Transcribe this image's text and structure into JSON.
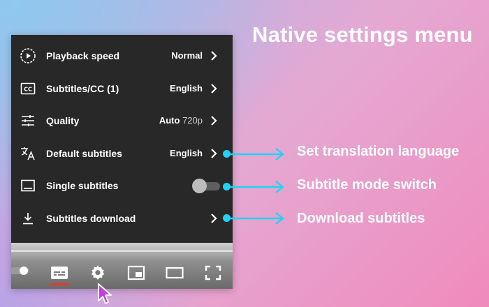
{
  "headline": "Native settings menu",
  "settings_menu": {
    "items": [
      {
        "label": "Playback speed",
        "value": "Normal",
        "icon": "playback-speed-icon"
      },
      {
        "label": "Subtitles/CC (1)",
        "value": "English",
        "icon": "closed-captions-icon"
      },
      {
        "label": "Quality",
        "value": "Auto",
        "value_sub": "720p",
        "icon": "quality-sliders-icon"
      },
      {
        "label": "Default subtitles",
        "value": "English",
        "icon": "translate-icon"
      },
      {
        "label": "Single subtitles",
        "toggle_on": false,
        "icon": "subtitles-box-icon"
      },
      {
        "label": "Subtitles download",
        "icon": "download-icon"
      }
    ]
  },
  "player_controls": {
    "buttons": [
      "autoplay-toggle-icon",
      "subtitles-icon",
      "settings-gear-icon",
      "miniplayer-icon",
      "theater-mode-icon",
      "fullscreen-icon"
    ],
    "subtitles_active": true
  },
  "callouts": [
    {
      "label": "Set translation language"
    },
    {
      "label": "Subtitle mode switch"
    },
    {
      "label": "Download subtitles"
    }
  ],
  "colors": {
    "menu_background": "#282828",
    "accent_cyan": "#1ed4f2",
    "cc_underline": "#e53935",
    "text": "#ffffff"
  }
}
